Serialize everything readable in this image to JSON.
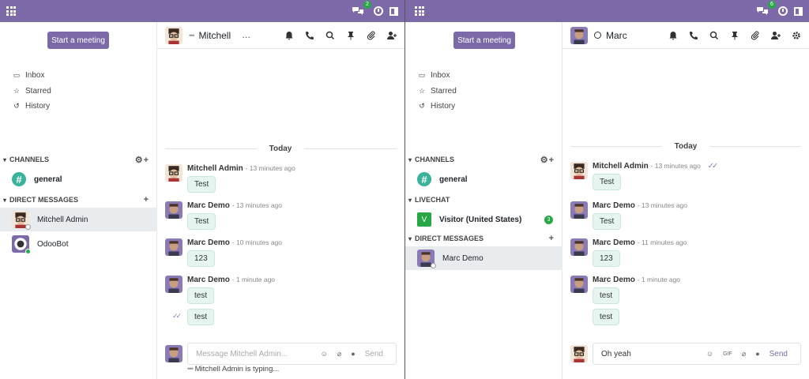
{
  "left": {
    "chat_badge": "2",
    "meeting_button": "Start a meeting",
    "nav": [
      "Inbox",
      "Starred",
      "History"
    ],
    "sections": {
      "channels": "CHANNELS",
      "direct": "DIRECT MESSAGES"
    },
    "channels": [
      {
        "name": "general"
      }
    ],
    "direct": [
      {
        "name": "Mitchell Admin"
      },
      {
        "name": "OdooBot"
      }
    ],
    "thread_title": "Mitchell",
    "thread_status": "…",
    "day_separator": "Today",
    "messages": [
      {
        "author": "Mitchell Admin",
        "time": "- 13 minutes ago",
        "bubbles": [
          "Test"
        ]
      },
      {
        "author": "Marc Demo",
        "time": "- 13 minutes ago",
        "bubbles": [
          "Test"
        ]
      },
      {
        "author": "Marc Demo",
        "time": "- 10 minutes ago",
        "bubbles": [
          "123"
        ]
      },
      {
        "author": "Marc Demo",
        "time": "- 1 minute ago",
        "bubbles": [
          "test",
          "test"
        ]
      }
    ],
    "composer_placeholder": "Message Mitchell Admin...",
    "send_label": "Send",
    "typing": "Mitchell Admin is typing..."
  },
  "right": {
    "chat_badge": "6",
    "meeting_button": "Start a meeting",
    "nav": [
      "Inbox",
      "Starred",
      "History"
    ],
    "sections": {
      "channels": "CHANNELS",
      "livechat": "LIVECHAT",
      "direct": "DIRECT MESSAGES"
    },
    "channels": [
      {
        "name": "general"
      }
    ],
    "livechat": [
      {
        "name": "Visitor (United States)",
        "initial": "V",
        "count": "3"
      }
    ],
    "direct": [
      {
        "name": "Marc Demo"
      }
    ],
    "thread_title": "Marc",
    "day_separator": "Today",
    "messages": [
      {
        "author": "Mitchell Admin",
        "time": "- 13 minutes ago",
        "bubbles": [
          "Test"
        ]
      },
      {
        "author": "Marc Demo",
        "time": "- 13 minutes ago",
        "bubbles": [
          "Test"
        ]
      },
      {
        "author": "Marc Demo",
        "time": "- 11 minutes ago",
        "bubbles": [
          "123"
        ]
      },
      {
        "author": "Marc Demo",
        "time": "- 1 minute ago",
        "bubbles": [
          "test",
          "test"
        ]
      }
    ],
    "composer_value": "Oh yeah",
    "gif_label": "GIF",
    "send_label": "Send"
  },
  "colors": {
    "brand": "#7c6aa8",
    "online": "#28a745",
    "channel": "#3bb29a",
    "bubble": "#e6f5f0"
  },
  "icons": [
    "apps-icon",
    "chat-icon",
    "clock-icon",
    "panel-icon",
    "inbox-icon",
    "star-icon",
    "history-icon",
    "gear-icon",
    "plus-icon",
    "bell-icon",
    "phone-icon",
    "search-icon",
    "pin-icon",
    "paperclip-icon",
    "add-user-icon",
    "smiley-icon",
    "microphone-icon"
  ]
}
